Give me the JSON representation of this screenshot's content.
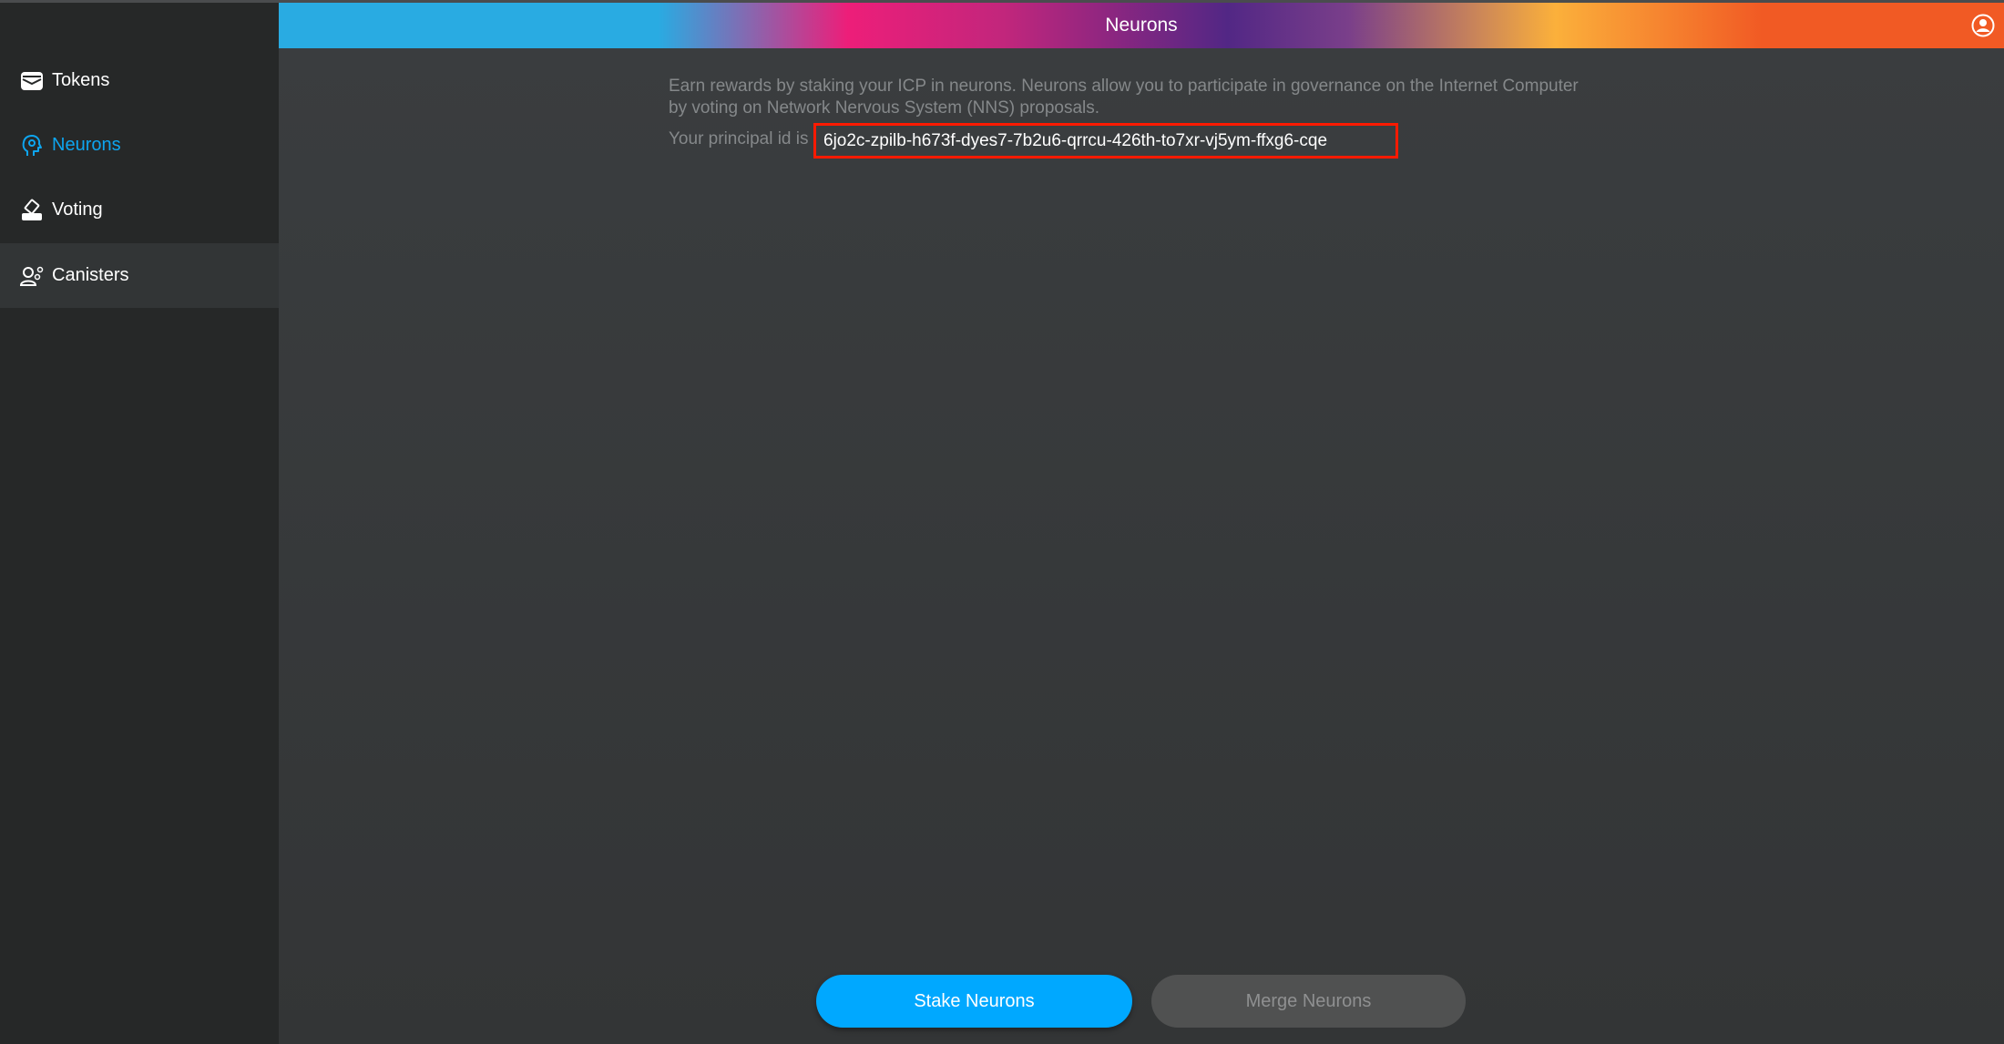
{
  "header": {
    "title": "Neurons",
    "account_icon": "user-circle-icon"
  },
  "sidebar": {
    "items": [
      {
        "label": "Tokens",
        "icon": "wallet-icon",
        "active": false
      },
      {
        "label": "Neurons",
        "icon": "head-gear-icon",
        "active": true
      },
      {
        "label": "Voting",
        "icon": "ballot-box-icon",
        "active": false
      },
      {
        "label": "Canisters",
        "icon": "user-gears-icon",
        "active": false
      }
    ]
  },
  "main": {
    "description": "Earn rewards by staking your ICP in neurons. Neurons allow you to participate in governance on the Internet Computer by voting on Network Nervous System (NNS) proposals.",
    "principal_prefix": "Your principal id is",
    "principal_id": "6jo2c-zpilb-h673f-dyes7-7b2u6-qrrcu-426th-to7xr-vj5ym-ffxg6-cqe",
    "stake_button": "Stake Neurons",
    "merge_button": "Merge Neurons"
  },
  "colors": {
    "accent": "#00a8ff",
    "highlight_box": "#ff1a00"
  }
}
